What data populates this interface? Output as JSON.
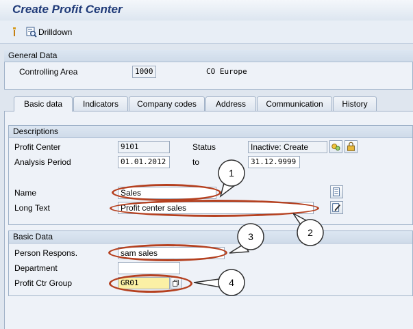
{
  "window": {
    "title": "Create Profit Center"
  },
  "toolbar": {
    "drilldown_label": "Drilldown"
  },
  "general_data": {
    "header": "General Data",
    "controlling_area_label": "Controlling Area",
    "controlling_area_value": "1000",
    "controlling_area_desc": "CO Europe"
  },
  "tabs": [
    {
      "label": "Basic data",
      "active": true
    },
    {
      "label": "Indicators"
    },
    {
      "label": "Company codes"
    },
    {
      "label": "Address"
    },
    {
      "label": "Communication"
    },
    {
      "label": "History"
    }
  ],
  "descriptions": {
    "header": "Descriptions",
    "profit_center_label": "Profit Center",
    "profit_center_value": "9101",
    "status_label": "Status",
    "status_value": "Inactive: Create",
    "analysis_period_label": "Analysis Period",
    "period_from": "01.01.2012",
    "to_label": "to",
    "period_to": "31.12.9999",
    "name_label": "Name",
    "name_value": "Sales",
    "long_text_label": "Long Text",
    "long_text_value": "Profit center sales"
  },
  "basic_data": {
    "header": "Basic Data",
    "person_resp_label": "Person Respons.",
    "person_resp_value": "sam sales",
    "department_label": "Department",
    "department_value": "",
    "profit_ctr_group_label": "Profit Ctr Group",
    "profit_ctr_group_value": "GR01"
  },
  "annotations": {
    "numbers": [
      "1",
      "2",
      "3",
      "4"
    ],
    "color": "#b5401f"
  },
  "colors": {
    "title_text": "#1f3a78",
    "background": "#dfe6ef",
    "required_field": "#fbf0a5"
  }
}
